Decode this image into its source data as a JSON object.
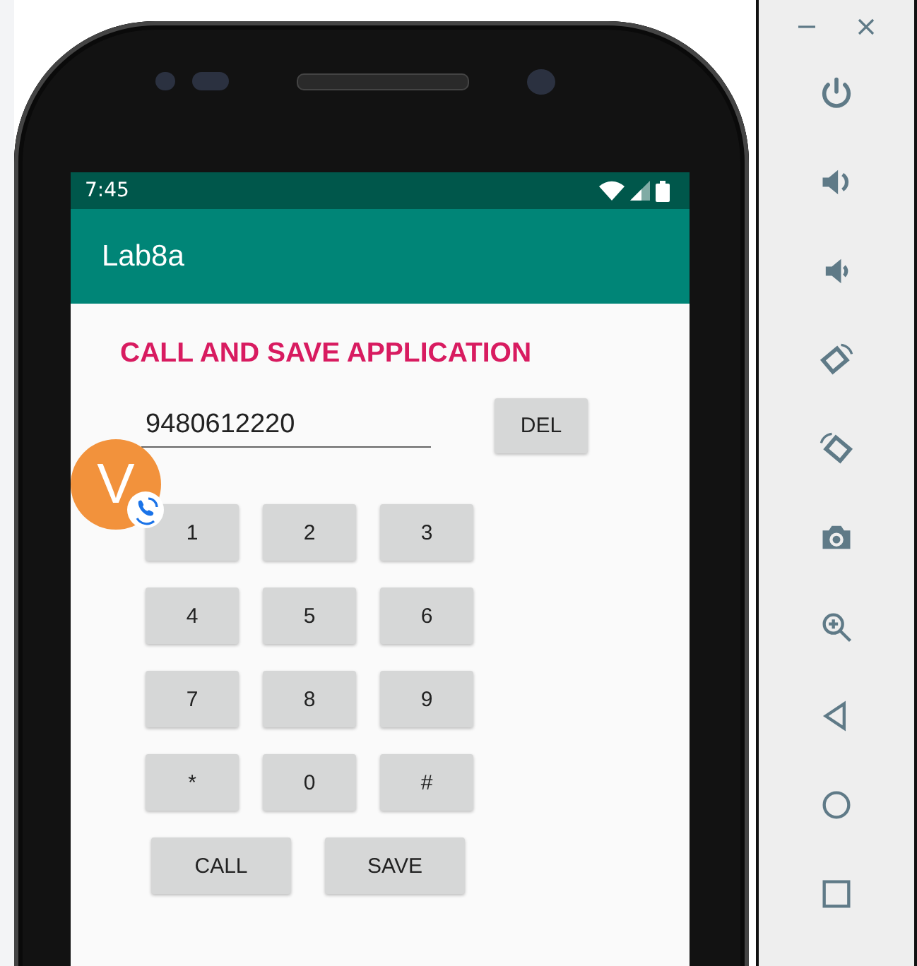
{
  "status_bar": {
    "time": "7:45"
  },
  "app_bar": {
    "title": "Lab8a"
  },
  "heading": "CALL AND SAVE APPLICATION",
  "number_field": {
    "value": "9480612220"
  },
  "delete_button": {
    "label": "DEL"
  },
  "keypad": [
    {
      "label": "1"
    },
    {
      "label": "2"
    },
    {
      "label": "3"
    },
    {
      "label": "4"
    },
    {
      "label": "5"
    },
    {
      "label": "6"
    },
    {
      "label": "7"
    },
    {
      "label": "8"
    },
    {
      "label": "9"
    },
    {
      "label": "*"
    },
    {
      "label": "0"
    },
    {
      "label": "#"
    }
  ],
  "actions": [
    {
      "label": "CALL"
    },
    {
      "label": "SAVE"
    }
  ],
  "chat_head": {
    "letter": "V"
  }
}
